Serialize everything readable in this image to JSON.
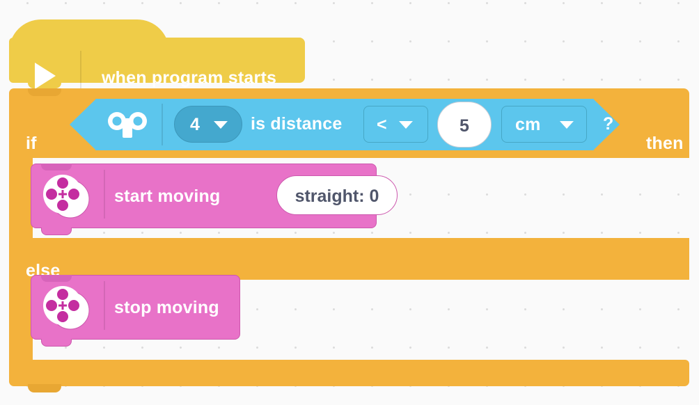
{
  "app": {
    "name": "block-programming-canvas",
    "background_color": "#fafafa",
    "grid_dot_color": "#dcdcdc"
  },
  "palette": {
    "hat_yellow": "#EFCC48",
    "control_orange": "#F3B23C",
    "control_orange_shadow": "#E8A733",
    "sensor_blue": "#5CC6ED",
    "sensor_blue_dark": "#44A8CE",
    "motion_pink": "#E872C8",
    "motion_pink_dark": "#CC57AD",
    "input_white": "#FFFFFF",
    "input_text": "#50566B",
    "label_white": "#FFFFFF"
  },
  "script": {
    "hat_block": {
      "icon": "play-triangle-icon",
      "label": "when program starts"
    },
    "if_else_block": {
      "if_label": "if",
      "then_label": "then",
      "else_label": "else",
      "condition": {
        "icon": "distance-sensor-icon",
        "port": {
          "value": "4",
          "caret": "chevron-down-icon"
        },
        "predicate_label": "is distance",
        "operator": {
          "value": "<",
          "caret": "chevron-down-icon"
        },
        "threshold": "5",
        "unit": {
          "value": "cm",
          "caret": "chevron-down-icon"
        },
        "question_mark": "?"
      },
      "then_branch": [
        {
          "icon": "movement-icon",
          "label": "start moving",
          "argument": "straight: 0"
        }
      ],
      "else_branch": [
        {
          "icon": "movement-icon",
          "label": "stop moving"
        }
      ]
    }
  }
}
